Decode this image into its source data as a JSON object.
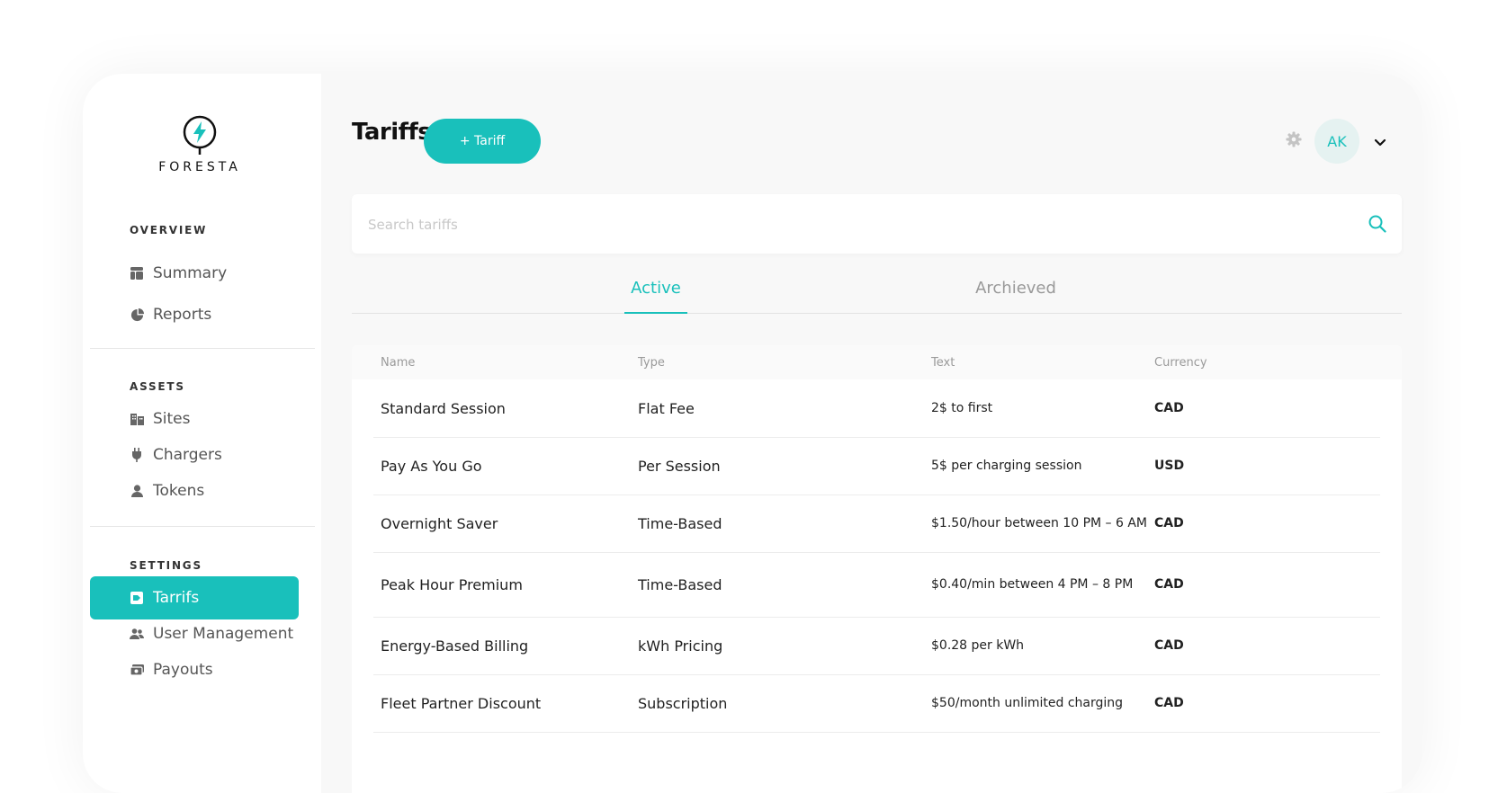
{
  "brand": {
    "name": "FORESTA",
    "accent": "#19c0bb"
  },
  "sidebar": {
    "sections": [
      {
        "label": "OVERVIEW",
        "items": [
          {
            "label": "Summary",
            "icon": "summary-icon"
          },
          {
            "label": "Reports",
            "icon": "pie-chart-icon"
          }
        ]
      },
      {
        "label": "ASSETS",
        "items": [
          {
            "label": "Sites",
            "icon": "building-icon"
          },
          {
            "label": "Chargers",
            "icon": "plug-icon"
          },
          {
            "label": "Tokens",
            "icon": "person-icon"
          }
        ]
      },
      {
        "label": "SETTINGS",
        "items": [
          {
            "label": "Tarrifs",
            "icon": "tag-icon",
            "active": true
          },
          {
            "label": "User Management",
            "icon": "users-icon"
          },
          {
            "label": "Payouts",
            "icon": "payout-icon"
          }
        ]
      }
    ]
  },
  "header": {
    "title": "Tariffs",
    "add_button": "+ Tariff",
    "avatar_initials": "AK"
  },
  "search": {
    "placeholder": "Search tariffs",
    "value": ""
  },
  "tabs": [
    {
      "label": "Active",
      "active": true
    },
    {
      "label": "Archieved",
      "active": false
    }
  ],
  "table": {
    "columns": [
      "Name",
      "Type",
      "Text",
      "Currency"
    ],
    "rows": [
      {
        "name": "Standard Session",
        "type": "Flat Fee",
        "text": "2$ to first",
        "currency": "CAD"
      },
      {
        "name": "Pay As You Go",
        "type": "Per Session",
        "text": "5$ per charging session",
        "currency": "USD"
      },
      {
        "name": "Overnight Saver",
        "type": "Time-Based",
        "text": "$1.50/hour between 10 PM – 6 AM",
        "currency": "CAD"
      },
      {
        "name": "Peak Hour Premium",
        "type": "Time-Based",
        "text": "$0.40/min between 4 PM – 8 PM",
        "currency": "CAD"
      },
      {
        "name": "Energy-Based Billing",
        "type": "kWh Pricing",
        "text": "$0.28 per kWh",
        "currency": "CAD"
      },
      {
        "name": "Fleet Partner Discount",
        "type": "Subscription",
        "text": "$50/month unlimited charging",
        "currency": "CAD"
      }
    ]
  }
}
